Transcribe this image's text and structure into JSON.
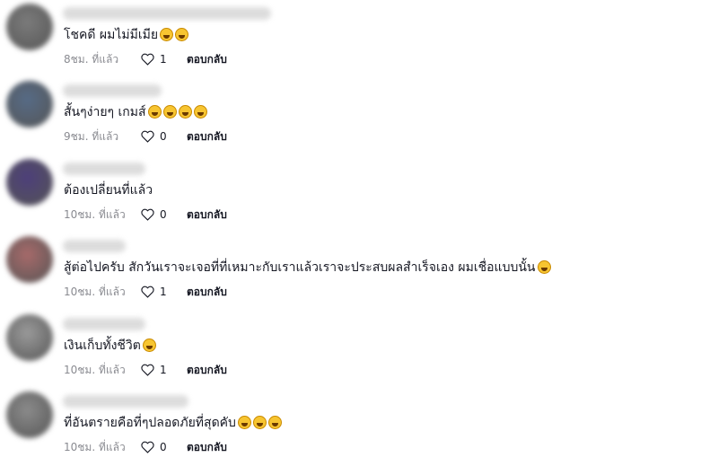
{
  "comments": [
    {
      "text": "โชคดี ผมไม่มีเมีย",
      "emojis": [
        "grinning-sweat-emoji",
        "grinning-sweat-emoji"
      ],
      "time": "8ชม. ที่แล้ว",
      "likes": "1",
      "reply": "ตอบกลับ",
      "avatar_color": "#7b7b7b",
      "name_width": 232
    },
    {
      "text": "สั้นๆง่ายๆ เกมส์",
      "emojis": [
        "rofl-emoji",
        "rofl-emoji",
        "rofl-emoji",
        "rofl-emoji"
      ],
      "time": "9ชม. ที่แล้ว",
      "likes": "0",
      "reply": "ตอบกลับ",
      "avatar_color": "#566b86",
      "name_width": 110
    },
    {
      "text": "ต้องเปลี่ยนที่แล้ว",
      "emojis": [],
      "time": "10ชม. ที่แล้ว",
      "likes": "0",
      "reply": "ตอบกลับ",
      "avatar_color": "#4d3f7a",
      "name_width": 92
    },
    {
      "text": "สู้ต่อไปครับ สักวันเราจะเจอที่ที่เหมาะกับเราแล้วเราจะประสบผลสำเร็จเอง ผมเชื่อแบบนั้น",
      "emojis": [
        "grinning-sweat-emoji"
      ],
      "time": "10ชม. ที่แล้ว",
      "likes": "1",
      "reply": "ตอบกลับ",
      "avatar_color": "#a76a6a",
      "name_width": 70
    },
    {
      "text": "เงินเก็บทั้งชีวิต",
      "emojis": [
        "laughing-emoji"
      ],
      "time": "10ชม. ที่แล้ว",
      "likes": "1",
      "reply": "ตอบกลับ",
      "avatar_color": "#9a9a9a",
      "name_width": 92
    },
    {
      "text": "ที่อันตรายคือที่ๆปลอดภัยที่สุดคับ",
      "emojis": [
        "laughing-emoji",
        "laughing-emoji",
        "laughing-emoji"
      ],
      "time": "10ชม. ที่แล้ว",
      "likes": "0",
      "reply": "ตอบกลับ",
      "avatar_color": "#8b8b8b",
      "name_width": 140
    }
  ]
}
